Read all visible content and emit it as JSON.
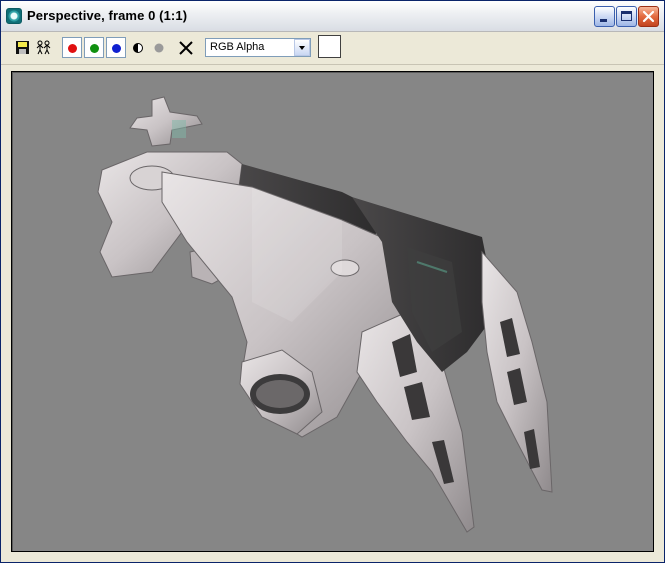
{
  "window": {
    "title": "Perspective, frame 0 (1:1)"
  },
  "toolbar": {
    "save_icon": "floppy-save-icon",
    "clone_icon": "clone-window-icon",
    "channels": [
      {
        "name": "red-channel",
        "color": "#e01010"
      },
      {
        "name": "green-channel",
        "color": "#109010"
      },
      {
        "name": "blue-channel",
        "color": "#1020d0"
      }
    ],
    "monochrome_icon": "half-circle-icon",
    "alpha_icon": "gray-dot-icon",
    "clear_icon": "x-clear-icon",
    "channel_select": {
      "value": "RGB Alpha"
    },
    "color_swatch": "#ffffff"
  },
  "viewport": {
    "background": "#868686",
    "content": "rendered-3d-spaceship"
  }
}
